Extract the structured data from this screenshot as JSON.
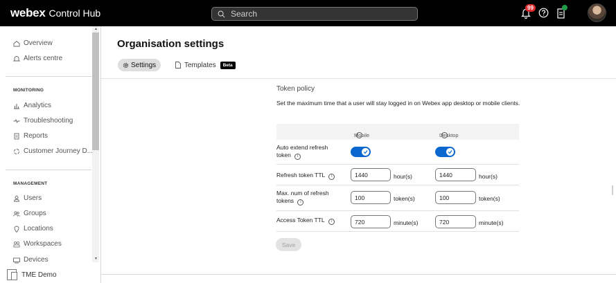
{
  "header": {
    "logo": "webex",
    "product": "Control Hub",
    "search_placeholder": "Search",
    "notification_count": "99"
  },
  "sidebar": {
    "top_items": [
      {
        "label": "Overview",
        "icon": "home-icon"
      },
      {
        "label": "Alerts centre",
        "icon": "bell-icon"
      }
    ],
    "monitoring_heading": "MONITORING",
    "monitoring_items": [
      {
        "label": "Analytics",
        "icon": "bar-chart-icon"
      },
      {
        "label": "Troubleshooting",
        "icon": "pulse-icon"
      },
      {
        "label": "Reports",
        "icon": "report-icon"
      },
      {
        "label": "Customer Journey D...",
        "icon": "journey-icon"
      }
    ],
    "management_heading": "MANAGEMENT",
    "management_items": [
      {
        "label": "Users",
        "icon": "user-icon"
      },
      {
        "label": "Groups",
        "icon": "groups-icon"
      },
      {
        "label": "Locations",
        "icon": "location-icon"
      },
      {
        "label": "Workspaces",
        "icon": "workspaces-icon"
      },
      {
        "label": "Devices",
        "icon": "devices-icon"
      }
    ],
    "footer_org": "TME Demo"
  },
  "main": {
    "title": "Organisation settings",
    "tabs": [
      {
        "label": "Settings",
        "icon": "gear-icon",
        "active": true
      },
      {
        "label": "Templates",
        "icon": "document-icon",
        "badge": "Beta",
        "active": false
      }
    ],
    "token_policy": {
      "title": "Token policy",
      "description": "Set the maximum time that a user will stay logged in on Webex app desktop or mobile clients.",
      "columns": {
        "mobile": "Mobile",
        "desktop": "Desktop"
      },
      "rows": {
        "auto_extend": {
          "label": "Auto extend refresh token",
          "mobile_on": true,
          "desktop_on": true
        },
        "refresh_ttl": {
          "label": "Refresh token TTL",
          "mobile_value": "1440",
          "desktop_value": "1440",
          "unit": "hour(s)"
        },
        "max_refresh": {
          "label": "Max. num of refresh tokens",
          "mobile_value": "100",
          "desktop_value": "100",
          "unit": "token(s)"
        },
        "access_ttl": {
          "label": "Access Token TTL",
          "mobile_value": "720",
          "desktop_value": "720",
          "unit": "minute(s)"
        }
      },
      "save_label": "Save"
    }
  },
  "colors": {
    "toggle_on": "#0b67d0",
    "topbar": "#000000",
    "badge_red": "#e02c2c",
    "badge_green": "#1d9d45"
  }
}
